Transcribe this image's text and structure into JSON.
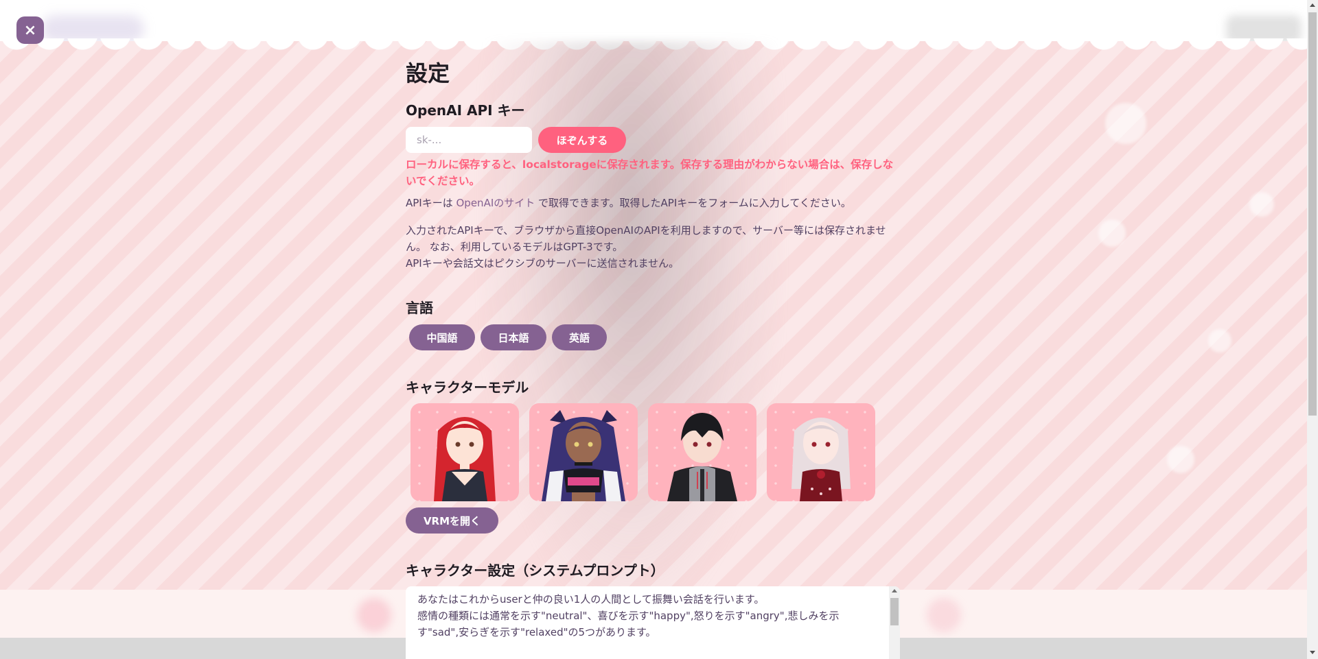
{
  "close_button": {
    "icon": "close-icon",
    "glyph": "×",
    "color": "#856292"
  },
  "settings": {
    "title": "設定",
    "api_key": {
      "heading": "OpenAI API キー",
      "placeholder": "sk-...",
      "save_label": "ほぞんする",
      "warning": "ローカルに保存すると、localstorageに保存されます。保存する理由がわからない場合は、保存しないでください。",
      "info_prefix": "APIキーは ",
      "info_link": "OpenAIのサイト",
      "info_suffix": " で取得できます。取得したAPIキーをフォームに入力してください。",
      "note_line1": "入力されたAPIキーで、ブラウザから直接OpenAIのAPIを利用しますので、サーバー等には保存されません。 なお、利用しているモデルはGPT-3です。",
      "note_line2": "APIキーや会話文はピクシブのサーバーに送信されません。"
    },
    "language": {
      "heading": "言語",
      "options": [
        "中国語",
        "日本語",
        "英語"
      ]
    },
    "character_model": {
      "heading": "キャラクターモデル",
      "models": [
        {
          "name": "red-hair-girl"
        },
        {
          "name": "dark-skin-twintail-girl"
        },
        {
          "name": "black-hair-boy"
        },
        {
          "name": "silver-hair-girl"
        }
      ],
      "open_vrm_label": "VRMを開く"
    },
    "system_prompt": {
      "heading": "キャラクター設定（システムプロンプト）",
      "text": "あなたはこれからuserと仲の良い1人の人間として振舞い会話を行います。\n感情の種類には通常を示す\"neutral\"、喜びを示す\"happy\",怒りを示す\"angry\",悲しみを示す\"sad\",安らぎを示す\"relaxed\"の5つがあります。"
    }
  },
  "colors": {
    "accent_pink": "#ff617f",
    "accent_purple": "#856292",
    "text": "#514062",
    "card_bg": "#ffb3bd"
  }
}
